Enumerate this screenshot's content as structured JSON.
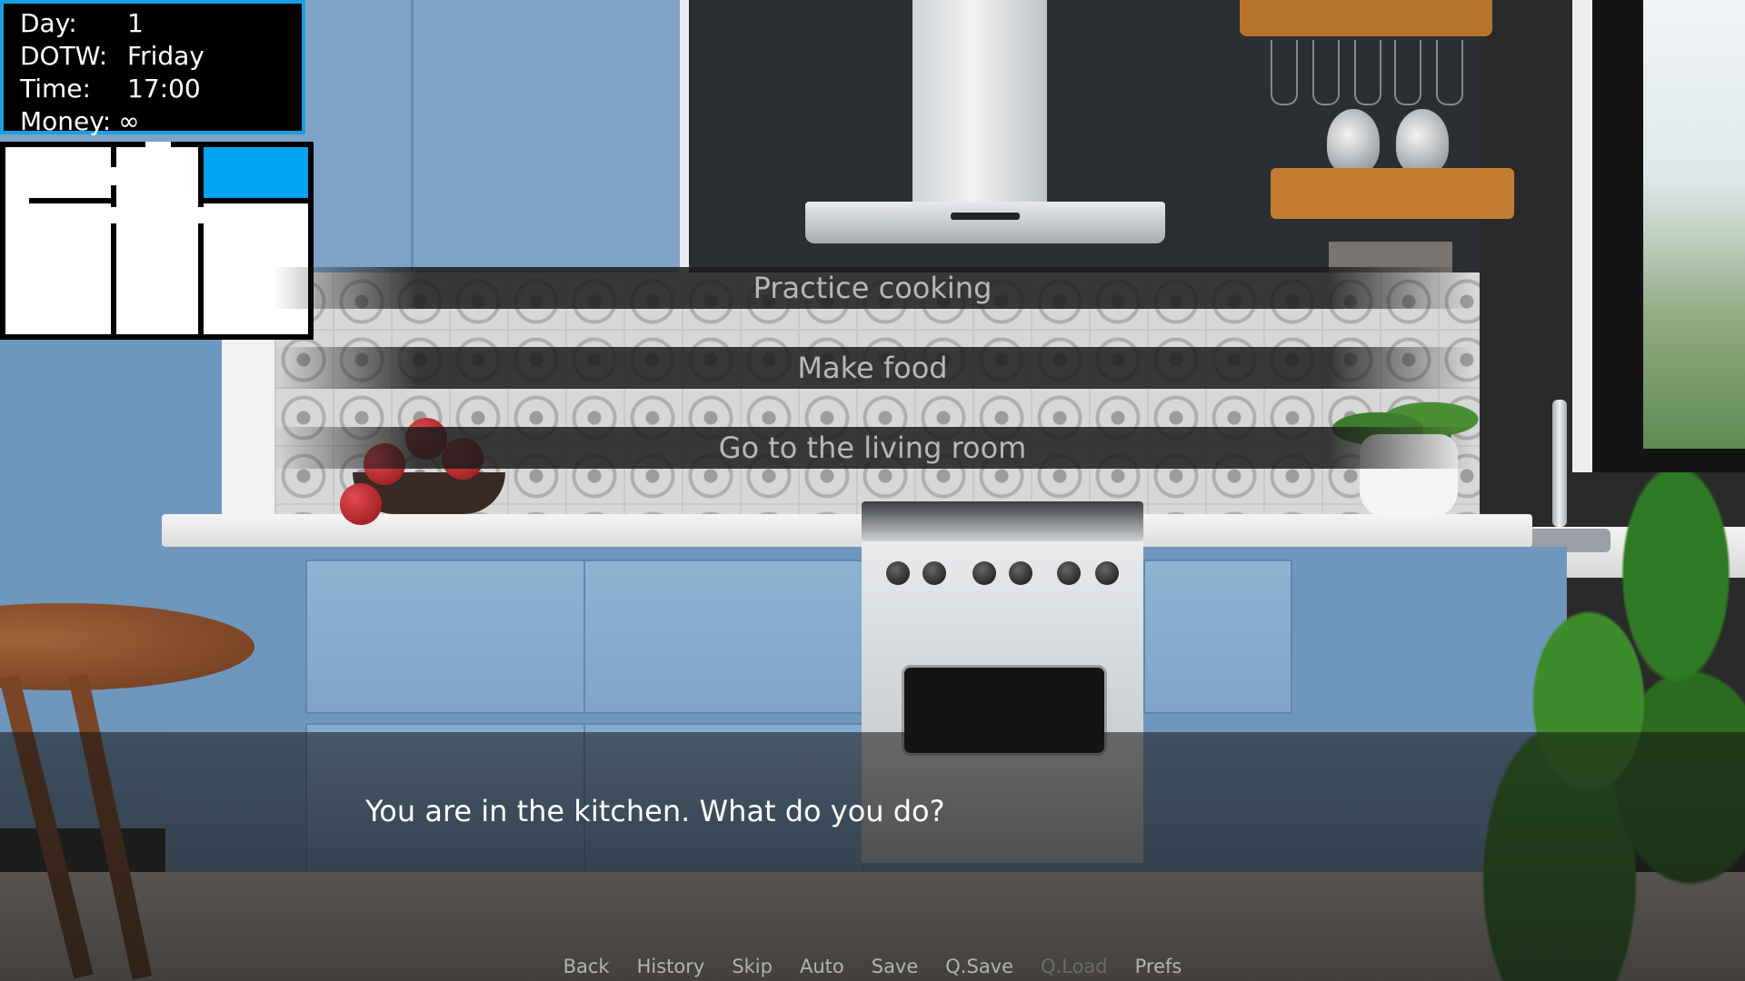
{
  "stats": {
    "day_label": "Day:",
    "day_value": "1",
    "dotw_label": "DOTW:",
    "dotw_value": "Friday",
    "time_label": "Time:",
    "time_value": "17:00",
    "money_label": "Money:",
    "money_value": "∞"
  },
  "map": {
    "current_room_color": "#00a3f0"
  },
  "choices": [
    {
      "label": "Practice cooking"
    },
    {
      "label": "Make food"
    },
    {
      "label": "Go to the living room"
    }
  ],
  "dialogue": {
    "text": "You are in the kitchen. What do you do?"
  },
  "quick_menu": {
    "back": "Back",
    "history": "History",
    "skip": "Skip",
    "auto": "Auto",
    "save": "Save",
    "qsave": "Q.Save",
    "qload": "Q.Load",
    "prefs": "Prefs"
  }
}
